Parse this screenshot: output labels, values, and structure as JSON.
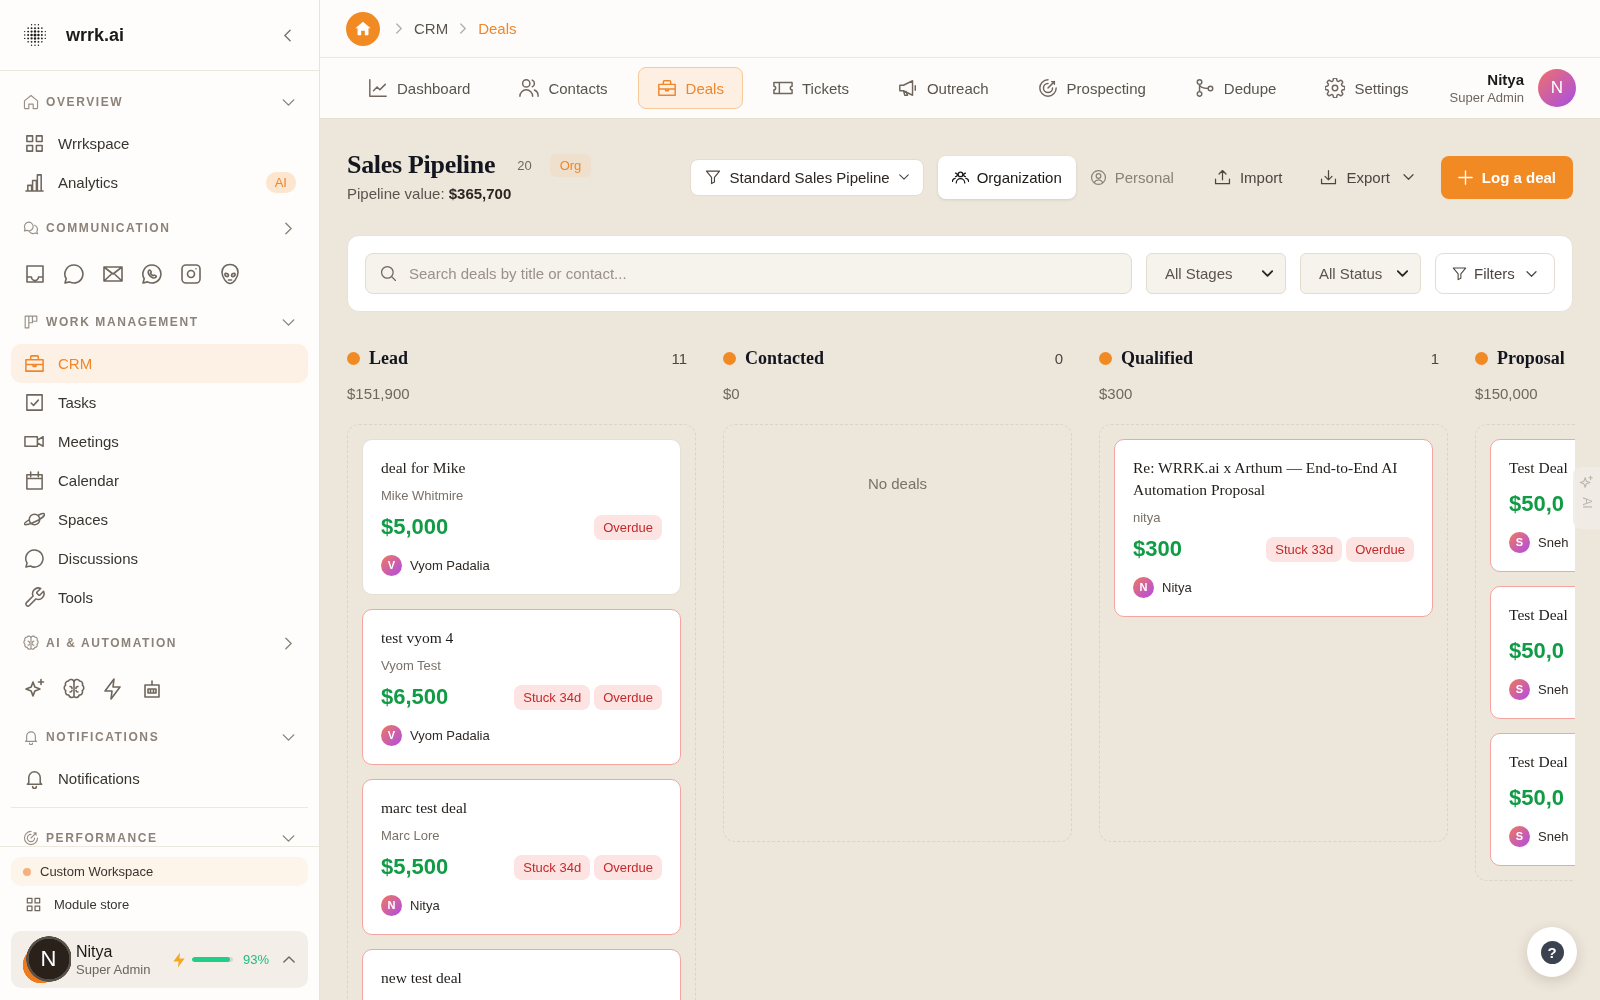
{
  "sidebar": {
    "brand": "wrrk.ai",
    "sections": [
      {
        "kind": "list",
        "title": "OVERVIEW",
        "expanded": true,
        "items": [
          {
            "label": "Wrrkspace",
            "selected": false
          },
          {
            "label": "Analytics",
            "badge": "AI",
            "selected": false
          }
        ]
      },
      {
        "kind": "icons",
        "title": "COMMUNICATION",
        "expanded": false
      },
      {
        "kind": "list",
        "title": "WORK MANAGEMENT",
        "expanded": true,
        "items": [
          {
            "label": "CRM",
            "selected": true
          },
          {
            "label": "Tasks",
            "selected": false
          },
          {
            "label": "Meetings",
            "selected": false
          },
          {
            "label": "Calendar",
            "selected": false
          },
          {
            "label": "Spaces",
            "selected": false
          },
          {
            "label": "Discussions",
            "selected": false
          },
          {
            "label": "Tools",
            "selected": false
          }
        ]
      },
      {
        "kind": "icons",
        "title": "AI & AUTOMATION",
        "expanded": false
      },
      {
        "kind": "list",
        "title": "NOTIFICATIONS",
        "expanded": true,
        "items": [
          {
            "label": "Notifications",
            "selected": false
          }
        ]
      },
      {
        "kind": "list",
        "title": "PERFORMANCE",
        "expanded": true
      }
    ],
    "footer_links": [
      {
        "kind": "workspace",
        "label": "Custom Workspace"
      },
      {
        "kind": "store",
        "label": "Module store"
      }
    ],
    "user": {
      "initial": "N",
      "name": "Nitya",
      "role": "Super Admin",
      "level": 0.93,
      "usage": "93%"
    }
  },
  "breadcrumb": [
    {
      "label": "CRM",
      "current": false
    },
    {
      "label": "Deals",
      "current": true
    }
  ],
  "nav": {
    "tabs": [
      {
        "label": "Dashboard",
        "selected": false
      },
      {
        "label": "Contacts",
        "selected": false
      },
      {
        "label": "Deals",
        "selected": true
      },
      {
        "label": "Tickets",
        "selected": false
      },
      {
        "label": "Outreach",
        "selected": false
      },
      {
        "label": "Prospecting",
        "selected": false
      },
      {
        "label": "Dedupe",
        "selected": false
      },
      {
        "label": "Settings",
        "selected": false
      }
    ],
    "user": {
      "name": "Nitya",
      "role": "Super Admin",
      "initial": "N"
    }
  },
  "header": {
    "title": "Sales Pipeline",
    "count": "20",
    "scope": "Org",
    "pipeline_value": "Pipeline value: **$365,700**"
  },
  "toolbar": {
    "pipeline": "Standard Sales Pipeline",
    "views": [
      {
        "label": "Organization",
        "selected": true
      },
      {
        "label": "Personal",
        "selected": false
      }
    ],
    "actions": [
      {
        "label": "Import",
        "dropdown": false
      },
      {
        "label": "Export",
        "dropdown": true
      }
    ],
    "primary": "Log a deal"
  },
  "filters": {
    "search": {
      "placeholder": "Search deals by title or contact..."
    },
    "selects": [
      "All Stages",
      "All Status"
    ],
    "button": "Filters"
  },
  "board": {
    "columns": [
      {
        "name": "Lead",
        "count": "11",
        "total": "$151,900",
        "deals": [
          {
            "title": "deal for Mike",
            "contact": "Mike Whitmire",
            "amount": "$5,000",
            "tags": [
              "Overdue"
            ],
            "owner": {
              "initial": "V",
              "name": "Vyom Padalia"
            },
            "at_risk": false
          },
          {
            "title": "test vyom 4",
            "contact": "Vyom Test",
            "amount": "$6,500",
            "tags": [
              "Stuck 34d",
              "Overdue"
            ],
            "owner": {
              "initial": "V",
              "name": "Vyom Padalia"
            },
            "at_risk": true
          },
          {
            "title": "marc test deal",
            "contact": "Marc Lore",
            "amount": "$5,500",
            "tags": [
              "Stuck 34d",
              "Overdue"
            ],
            "owner": {
              "initial": "N",
              "name": "Nitya"
            },
            "at_risk": true
          },
          {
            "title": "new test deal",
            "at_risk": true
          }
        ]
      },
      {
        "name": "Contacted",
        "count": "0",
        "total": "$0",
        "empty_text": "No deals"
      },
      {
        "name": "Qualified",
        "count": "1",
        "total": "$300",
        "deals": [
          {
            "title": "Re: WRRK.ai x Arthum — End-to-End AI Automation Proposal",
            "contact": "nitya",
            "amount": "$300",
            "tags": [
              "Stuck 33d",
              "Overdue"
            ],
            "owner": {
              "initial": "N",
              "name": "Nitya"
            },
            "at_risk": true
          }
        ]
      },
      {
        "name": "Proposal",
        "total": "$150,000",
        "deals": [
          {
            "title": "Test Deal",
            "amount": "$50,0",
            "owner": {
              "initial": "S",
              "name": "Sneh"
            },
            "at_risk": true
          },
          {
            "title": "Test Deal",
            "amount": "$50,0",
            "owner": {
              "initial": "S",
              "name": "Sneh"
            },
            "at_risk": true
          },
          {
            "title": "Test Deal",
            "amount": "$50,0",
            "owner": {
              "initial": "S",
              "name": "Sneh"
            },
            "at_risk": true
          }
        ]
      }
    ]
  },
  "ai_tab": "AI",
  "help": "?"
}
